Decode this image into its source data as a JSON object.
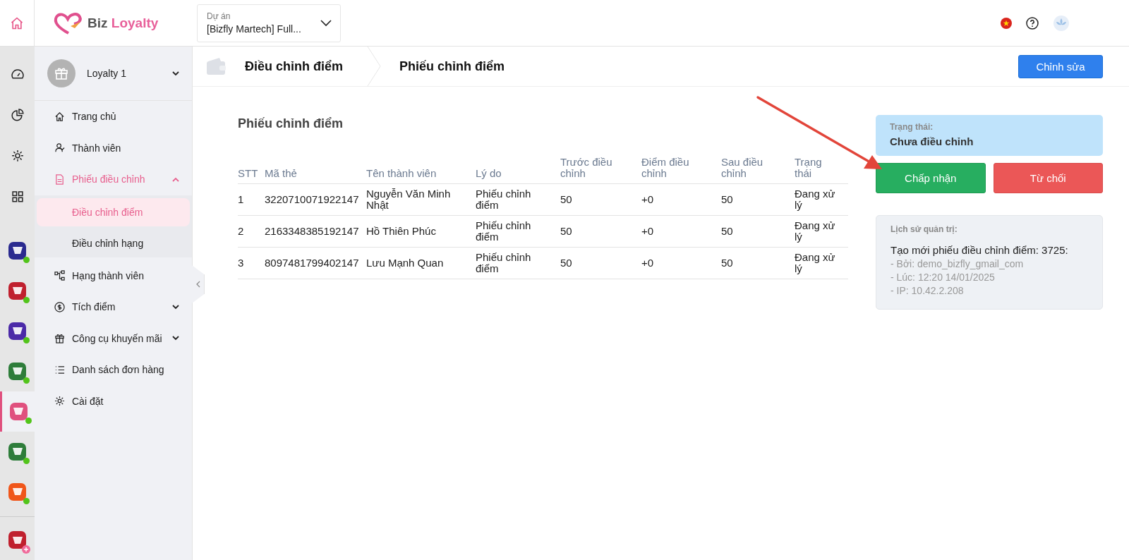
{
  "header": {
    "logo": [
      "Biz",
      "Loyalty"
    ],
    "project": {
      "label": "Dự án",
      "value": "[Bizfly Martech] Full..."
    }
  },
  "rail": {
    "apps": [
      {
        "color": "#2a2a8f",
        "selected": false,
        "online": true
      },
      {
        "color": "#c0202e",
        "selected": false,
        "online": true
      },
      {
        "color": "#4b2aa8",
        "selected": false,
        "online": true
      },
      {
        "color": "#2e7d3a",
        "selected": false,
        "online": true
      },
      {
        "color": "#e0507e",
        "selected": true,
        "online": true
      },
      {
        "color": "#2e7d3a",
        "selected": false,
        "online": true
      },
      {
        "color": "#f0561a",
        "selected": false,
        "online": true
      }
    ],
    "add_app": {
      "color": "#c0202e"
    }
  },
  "sidebar": {
    "account": "Loyalty 1",
    "items": [
      {
        "kind": "link",
        "label": "Trang chủ",
        "selected": false
      },
      {
        "kind": "link",
        "label": "Thành viên",
        "selected": false
      },
      {
        "kind": "group",
        "label": "Phiếu điều chỉnh",
        "selected": true,
        "expanded": true,
        "children": [
          {
            "label": "Điều chỉnh điểm",
            "selected": true
          },
          {
            "label": "Điều chỉnh hạng",
            "selected": false
          }
        ]
      },
      {
        "kind": "link",
        "label": "Hạng thành viên",
        "selected": false
      },
      {
        "kind": "group",
        "label": "Tích điểm",
        "selected": false,
        "expanded": false
      },
      {
        "kind": "group",
        "label": "Công cụ khuyến mãi",
        "selected": false,
        "expanded": false
      },
      {
        "kind": "link",
        "label": "Danh sách đơn hàng",
        "selected": false
      },
      {
        "kind": "link",
        "label": "Cài đặt",
        "selected": false
      }
    ]
  },
  "breadcrumb": [
    "Điều chỉnh điểm",
    "Phiếu chỉnh điểm"
  ],
  "edit_button": "Chỉnh sửa",
  "section_title": "Phiếu chỉnh điểm",
  "table": {
    "columns": [
      "STT",
      "Mã thẻ",
      "Tên thành viên",
      "Lý do",
      "Trước điều chỉnh",
      "Điểm điều chỉnh",
      "Sau điều chỉnh",
      "Trạng thái"
    ],
    "rows": [
      [
        "1",
        "3220710071922147",
        "Nguyễn Văn Minh Nhật",
        "Phiếu chỉnh điểm",
        "50",
        "+0",
        "50",
        "Đang xử lý"
      ],
      [
        "2",
        "2163348385192147",
        "Hồ Thiên Phúc",
        "Phiếu chỉnh điểm",
        "50",
        "+0",
        "50",
        "Đang xử lý"
      ],
      [
        "3",
        "8097481799402147",
        "Lưu Mạnh Quan",
        "Phiếu chỉnh điểm",
        "50",
        "+0",
        "50",
        "Đang xử lý"
      ]
    ]
  },
  "status": {
    "label": "Trạng thái:",
    "value": "Chưa điều chỉnh"
  },
  "actions": [
    "Chấp nhận",
    "Từ chối"
  ],
  "history": {
    "label": "Lịch sử quản trị:",
    "title": "Tạo mới phiếu điều chỉnh điểm: 3725:",
    "lines": [
      "- Bởi: demo_bizfly_gmail_com",
      "- Lúc: 12:20 14/01/2025",
      "- IP: 10.42.2.208"
    ]
  }
}
